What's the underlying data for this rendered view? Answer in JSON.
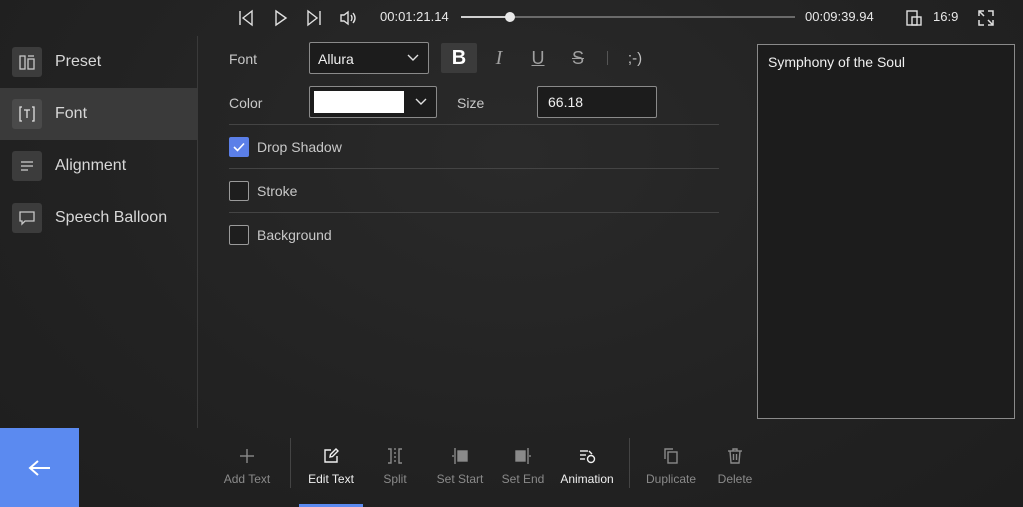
{
  "player": {
    "current_time": "00:01:21.14",
    "total_time": "00:09:39.94",
    "progress": 0.147,
    "aspect_ratio": "16:9"
  },
  "sidebar": {
    "items": [
      {
        "label": "Preset",
        "icon": "preset-icon",
        "active": false
      },
      {
        "label": "Font",
        "icon": "font-icon",
        "active": true
      },
      {
        "label": "Alignment",
        "icon": "alignment-icon",
        "active": false
      },
      {
        "label": "Speech Balloon",
        "icon": "speech-balloon-icon",
        "active": false
      }
    ]
  },
  "editor": {
    "font_label": "Font",
    "font_value": "Allura",
    "format": {
      "bold": "B",
      "italic": "I",
      "underline": "U",
      "strike": "S",
      "emoji": ";-)"
    },
    "color_label": "Color",
    "color_value": "#ffffff",
    "size_label": "Size",
    "size_value": "66.18",
    "options": [
      {
        "label": "Drop Shadow",
        "checked": true
      },
      {
        "label": "Stroke",
        "checked": false
      },
      {
        "label": "Background",
        "checked": false
      }
    ]
  },
  "preview": {
    "text": "Symphony of the Soul"
  },
  "toolbar": {
    "items": [
      {
        "label": "Add Text",
        "icon": "plus-icon"
      },
      {
        "label": "Edit Text",
        "icon": "edit-icon",
        "active": true
      },
      {
        "label": "Split",
        "icon": "split-icon"
      },
      {
        "label": "Set Start",
        "icon": "set-start-icon"
      },
      {
        "label": "Set End",
        "icon": "set-end-icon"
      },
      {
        "label": "Animation",
        "icon": "animation-icon"
      },
      {
        "label": "Duplicate",
        "icon": "duplicate-icon"
      },
      {
        "label": "Delete",
        "icon": "delete-icon"
      }
    ]
  },
  "colors": {
    "accent": "#5b8af0",
    "checkbox_on": "#5b7fe8"
  }
}
